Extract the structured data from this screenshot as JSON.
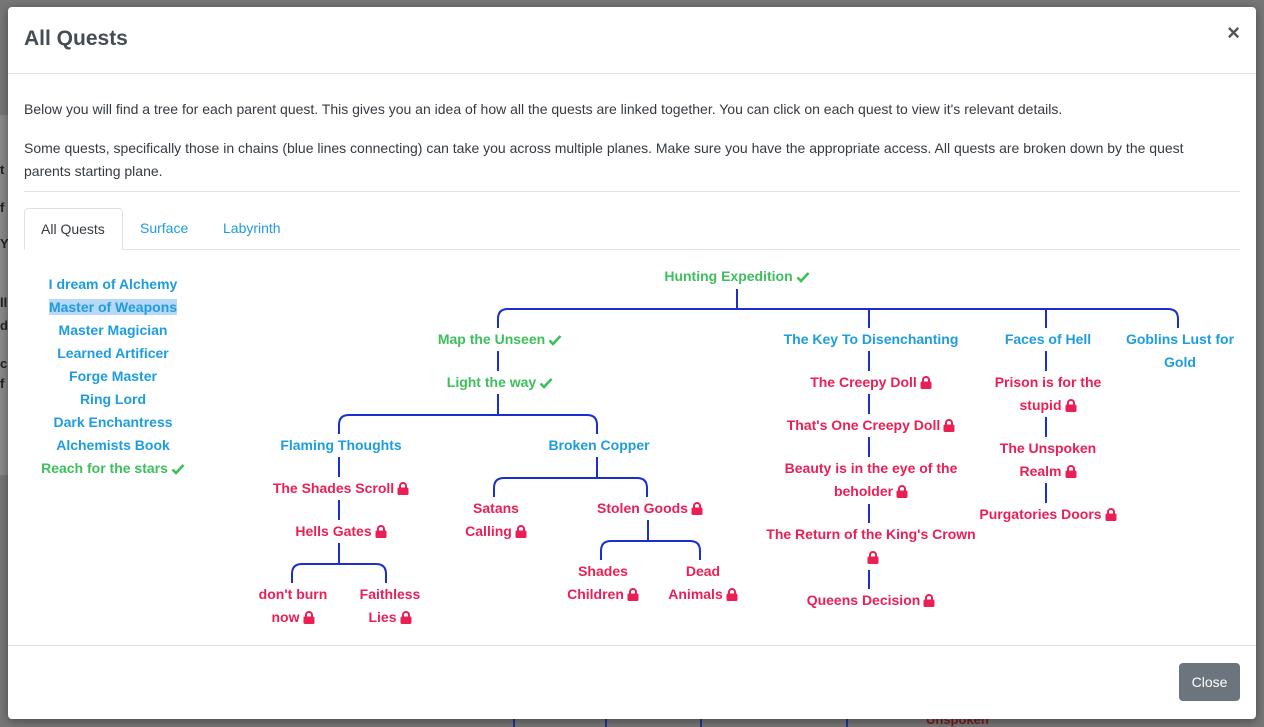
{
  "background": {
    "bottom_text": "Unspoken",
    "edge_glyphs": [
      "t",
      "f",
      "Y",
      "ll",
      "d",
      "c",
      "f"
    ]
  },
  "modal": {
    "title": "All Quests",
    "close_symbol": "×",
    "intro_1": "Below you will find a tree for each parent quest. This gives you an idea of how all the quests are linked together. You can click on each quest to view it's relevant details.",
    "intro_2": "Some quests, specifically those in chains (blue lines connecting) can take you across multiple planes. Make sure you have the appropriate access. All quests are broken down by the quest parents starting plane.",
    "close_button": "Close"
  },
  "tabs": [
    {
      "label": "All Quests",
      "active": true
    },
    {
      "label": "Surface",
      "active": false
    },
    {
      "label": "Labyrinth",
      "active": false
    }
  ],
  "quest_list": [
    {
      "label": "I dream of Alchemy",
      "status": "open"
    },
    {
      "label": "Master of Weapons",
      "status": "open",
      "highlighted": true
    },
    {
      "label": "Master Magician",
      "status": "open"
    },
    {
      "label": "Learned Artificer",
      "status": "open"
    },
    {
      "label": "Forge Master",
      "status": "open"
    },
    {
      "label": "Ring Lord",
      "status": "open"
    },
    {
      "label": "Dark Enchantress",
      "status": "open"
    },
    {
      "label": "Alchemists Book",
      "status": "open"
    },
    {
      "label": "Reach for the stars",
      "status": "complete"
    }
  ],
  "tree": {
    "root": {
      "line1": "Hunting Expedition",
      "status": "complete"
    },
    "map_unseen": {
      "line1": "Map the Unseen",
      "status": "complete"
    },
    "light_way": {
      "line1": "Light the way",
      "status": "complete"
    },
    "flaming": {
      "line1": "Flaming Thoughts",
      "status": "open"
    },
    "shades_scroll": {
      "line1": "The Shades Scroll",
      "status": "locked"
    },
    "hells_gates": {
      "line1": "Hells Gates",
      "status": "locked"
    },
    "dont_burn": {
      "line1": "don't burn",
      "line2": "now",
      "status": "locked"
    },
    "faithless": {
      "line1": "Faithless",
      "line2": "Lies",
      "status": "locked"
    },
    "broken_copper": {
      "line1": "Broken Copper",
      "status": "open"
    },
    "satans": {
      "line1": "Satans",
      "line2": "Calling",
      "status": "locked"
    },
    "stolen_goods": {
      "line1": "Stolen Goods",
      "status": "locked"
    },
    "shades_children": {
      "line1": "Shades",
      "line2": "Children",
      "status": "locked"
    },
    "dead_animals": {
      "line1": "Dead",
      "line2": "Animals",
      "status": "locked"
    },
    "key_disenchant": {
      "line1": "The Key To Disenchanting",
      "status": "open"
    },
    "creepy_doll": {
      "line1": "The Creepy Doll",
      "status": "locked"
    },
    "one_creepy": {
      "line1": "That's One Creepy Doll",
      "status": "locked"
    },
    "beauty": {
      "line1": "Beauty is in the eye of the",
      "line2": "beholder",
      "status": "locked"
    },
    "return_crown": {
      "line1": "The Return of the King's Crown",
      "line2": "",
      "status": "locked"
    },
    "queens": {
      "line1": "Queens Decision",
      "status": "locked"
    },
    "faces_hell": {
      "line1": "Faces of Hell",
      "status": "open"
    },
    "prison": {
      "line1": "Prison is for the",
      "line2": "stupid",
      "status": "locked"
    },
    "unspoken": {
      "line1": "The Unspoken",
      "line2": "Realm",
      "status": "locked"
    },
    "purgatories": {
      "line1": "Purgatories Doors",
      "status": "locked"
    },
    "goblins": {
      "line1": "Goblins Lust for",
      "line2": "Gold",
      "status": "open"
    }
  },
  "colors": {
    "link": "#1d9de0",
    "complete": "#3cbf5c",
    "locked": "#ea1f55",
    "tree_line": "#1a2fd1"
  }
}
